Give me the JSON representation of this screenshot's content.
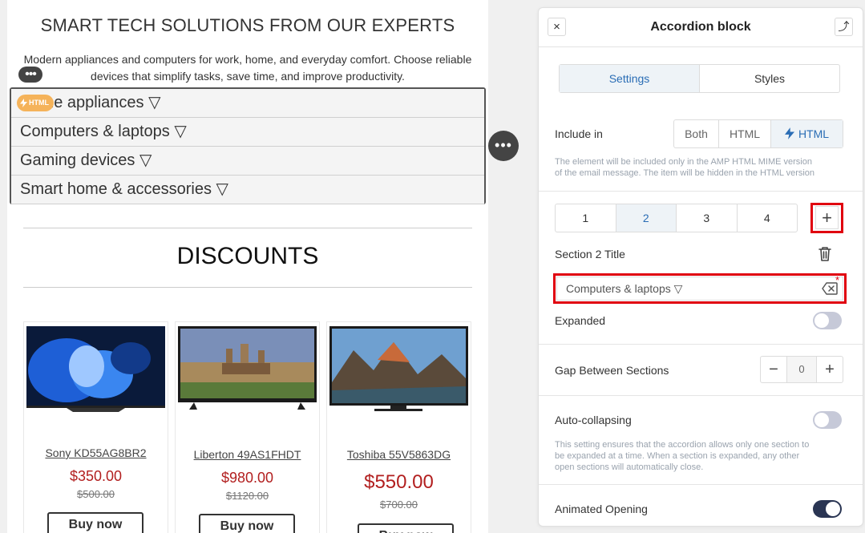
{
  "canvas": {
    "hero_title": "SMART TECH SOLUTIONS FROM OUR EXPERTS",
    "hero_desc_line1": "Modern appliances and computers for work, home, and everyday comfort. Choose reliable",
    "hero_desc_line2": "devices that simplify tasks, save time, and improve productivity.",
    "drag_handle": "•••",
    "html_badge": "HTML",
    "accordion_items": [
      "Home appliances ▽",
      "Computers & laptops ▽",
      "Gaming devices ▽",
      "Smart home & accessories ▽"
    ],
    "more_button": "•••",
    "discounts_title": "DISCOUNTS",
    "products": [
      {
        "name": "Sony KD55AG8BR2",
        "price": "$350.00",
        "old_price": "$500.00",
        "buy": "Buy now"
      },
      {
        "name": "Liberton 49AS1FHDT",
        "price": "$980.00",
        "old_price": "$1120.00",
        "buy": "Buy now"
      },
      {
        "name": "Toshiba 55V5863DG",
        "price": "$550.00",
        "old_price": "$700.00",
        "buy": "Buy now"
      }
    ]
  },
  "panel": {
    "title": "Accordion block",
    "close_icon": "×",
    "move_icon": "⤴",
    "tabs": [
      "Settings",
      "Styles"
    ],
    "include_label": "Include in",
    "include_options": [
      "Both",
      "HTML",
      "HTML"
    ],
    "include_hint_1": "The element will be included only in the AMP HTML MIME version",
    "include_hint_2": "of the email message. The item will be hidden in the HTML version",
    "sections": [
      "1",
      "2",
      "3",
      "4"
    ],
    "add_section": "+",
    "section_title_label": "Section 2 Title",
    "section_title_value": "Computers & laptops ▽",
    "required_mark": "*",
    "expanded_label": "Expanded",
    "expanded_on": false,
    "gap_label": "Gap Between Sections",
    "gap_minus": "−",
    "gap_value": "0",
    "gap_plus": "+",
    "auto_collapse_label": "Auto-collapsing",
    "auto_collapse_on": false,
    "auto_hint_1": "This setting ensures that the accordion allows only one section to",
    "auto_hint_2": "be expanded at a time. When a section is expanded, any other",
    "auto_hint_3": "open sections will automatically close.",
    "animated_label": "Animated Opening",
    "animated_on": true
  },
  "colors": {
    "accent_blue": "#2a6db5",
    "highlight_red": "#e0000f",
    "price_red": "#b21f1f",
    "badge_orange": "#f5b35a"
  }
}
